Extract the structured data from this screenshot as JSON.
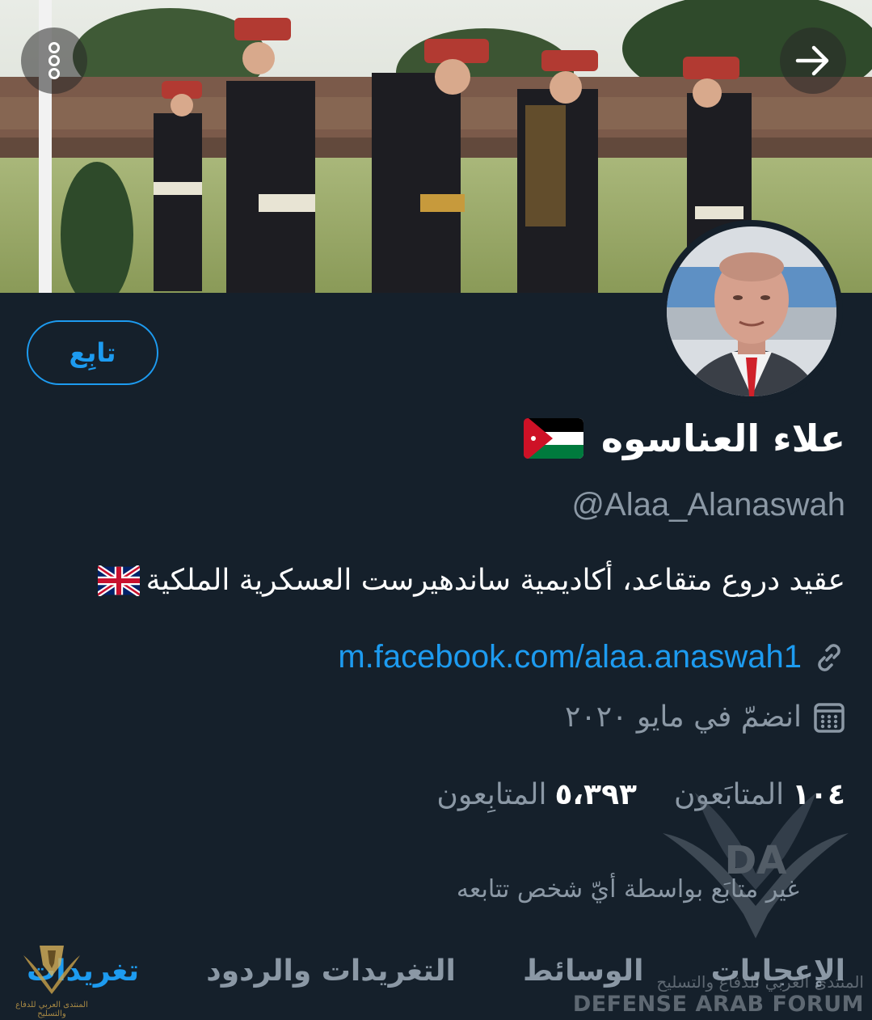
{
  "profile": {
    "name": "علاء العناسوه",
    "handle": "@Alaa_Alanaswah",
    "bio": "عقيد دروع متقاعد، أكاديمية ساندهيرست العسكرية الملكية",
    "link": "m.facebook.com/alaa.anaswah1",
    "joined": "انضمّ في مايو ٢٠٢٠",
    "following_count": "١٠٤",
    "following_label": "المتابَعون",
    "followers_count": "٥،٣٩٣",
    "followers_label": "المتابِعون",
    "mutual_note": "غير متابَع بواسطة أيّ شخص تتابعه"
  },
  "buttons": {
    "follow_label": "تابِع",
    "more_icon": "more-vertical-icon",
    "forward_icon": "arrow-right-icon"
  },
  "icons": {
    "link": "link-icon",
    "calendar": "calendar-icon",
    "name_flag": "jordan-flag-icon",
    "bio_flag": "uk-flag-icon"
  },
  "tabs": [
    {
      "label": "تغريدات",
      "active": true
    },
    {
      "label": "التغريدات والردود",
      "active": false
    },
    {
      "label": "الوسائط",
      "active": false
    },
    {
      "label": "الإعجابات",
      "active": false
    }
  ],
  "watermark": {
    "en": "DEFENSE ARAB FORUM",
    "ar": "المنتدى العربي للدفاع والتسليح",
    "logo_text": "DA",
    "left_caption": "المنتدى العربي للدفاع والتسليح"
  },
  "colors": {
    "background": "#15202b",
    "accent": "#1d9bf0",
    "muted": "#8b98a5"
  }
}
